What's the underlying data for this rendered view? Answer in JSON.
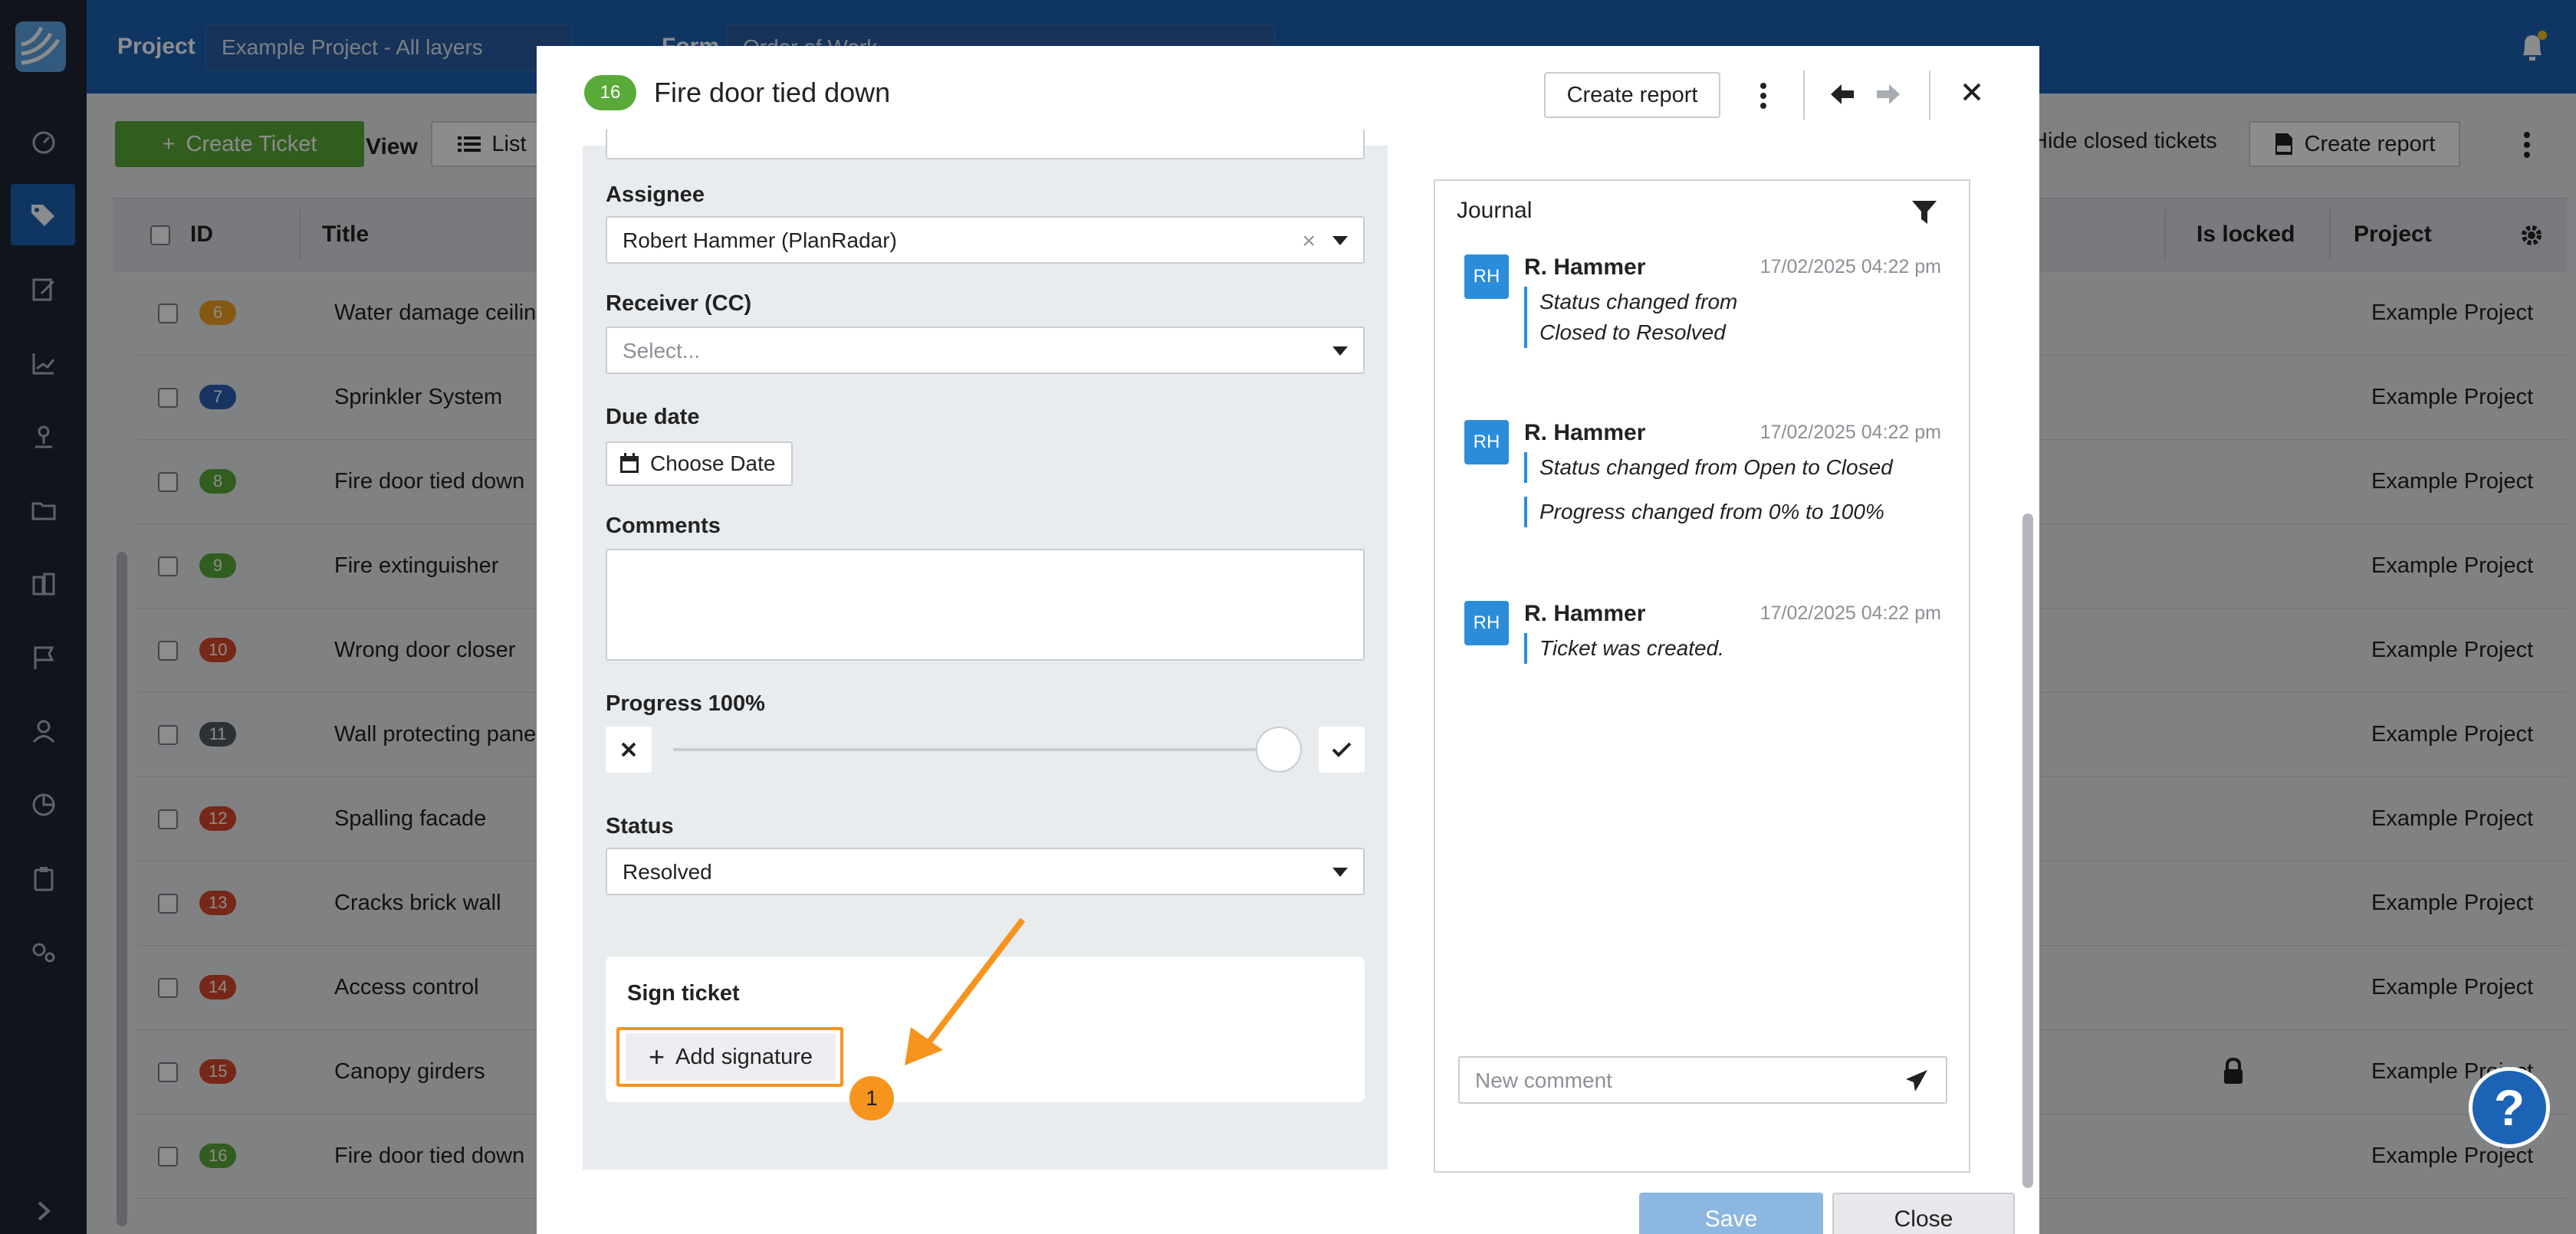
{
  "topbar": {
    "project_label": "Project",
    "project_value": "Example Project - All layers",
    "form_label": "Form",
    "form_value": "Order of Work"
  },
  "toolbar": {
    "create_ticket": "Create Ticket",
    "view_label": "View",
    "view_value": "List",
    "hide_closed": "Hide closed tickets",
    "create_report": "Create report"
  },
  "table": {
    "headers": {
      "id": "ID",
      "title": "Title",
      "is_locked": "Is locked",
      "project": "Project"
    },
    "rows": [
      {
        "id": "6",
        "color": "#f0a223",
        "title": "Water damage ceiling",
        "project": "Example Project",
        "locked": false
      },
      {
        "id": "7",
        "color": "#2c5fb5",
        "title": "Sprinkler System",
        "project": "Example Project",
        "locked": false
      },
      {
        "id": "8",
        "color": "#5aaa3a",
        "title": "Fire door tied down",
        "project": "Example Project",
        "locked": false
      },
      {
        "id": "9",
        "color": "#5aaa3a",
        "title": "Fire extinguisher",
        "project": "Example Project",
        "locked": false
      },
      {
        "id": "10",
        "color": "#d9472b",
        "title": "Wrong door closer",
        "project": "Example Project",
        "locked": false
      },
      {
        "id": "11",
        "color": "#555a5f",
        "title": "Wall protecting panel",
        "project": "Example Project",
        "locked": false
      },
      {
        "id": "12",
        "color": "#d9472b",
        "title": "Spalling facade",
        "project": "Example Project",
        "locked": false
      },
      {
        "id": "13",
        "color": "#d9472b",
        "title": "Cracks brick wall",
        "project": "Example Project",
        "locked": false
      },
      {
        "id": "14",
        "color": "#d9472b",
        "title": "Access control",
        "project": "Example Project",
        "locked": false
      },
      {
        "id": "15",
        "color": "#d9472b",
        "title": "Canopy girders",
        "project": "Example Project",
        "locked": true
      },
      {
        "id": "16",
        "color": "#5aaa3a",
        "title": "Fire door tied down",
        "project": "Example Project",
        "locked": false
      }
    ]
  },
  "modal": {
    "badge": "16",
    "badge_color": "#5aaa3a",
    "title": "Fire door tied down",
    "create_report": "Create report",
    "assignee_label": "Assignee",
    "assignee_value": "Robert Hammer (PlanRadar)",
    "receiver_label": "Receiver (CC)",
    "receiver_placeholder": "Select...",
    "due_label": "Due date",
    "due_button": "Choose Date",
    "comments_label": "Comments",
    "progress_label": "Progress 100%",
    "progress_value": 1.0,
    "status_label": "Status",
    "status_value": "Resolved",
    "sign_label": "Sign ticket",
    "add_signature": "Add signature",
    "callout_number": "1",
    "save": "Save",
    "close": "Close"
  },
  "journal": {
    "title": "Journal",
    "comment_placeholder": "New comment",
    "entries": [
      {
        "initials": "RH",
        "name": "R. Hammer",
        "time": "17/02/2025 04:22 pm",
        "messages": [
          "Status changed from Closed to Resolved"
        ]
      },
      {
        "initials": "RH",
        "name": "R. Hammer",
        "time": "17/02/2025 04:22 pm",
        "messages": [
          "Status changed from Open to Closed",
          "Progress changed from 0% to 100%"
        ]
      },
      {
        "initials": "RH",
        "name": "R. Hammer",
        "time": "17/02/2025 04:22 pm",
        "messages": [
          "Ticket was created."
        ]
      }
    ]
  },
  "colors": {
    "brand_blue": "#1d63b5",
    "accent_orange": "#f7941d",
    "green": "#5aaa3a"
  },
  "help_symbol": "?"
}
